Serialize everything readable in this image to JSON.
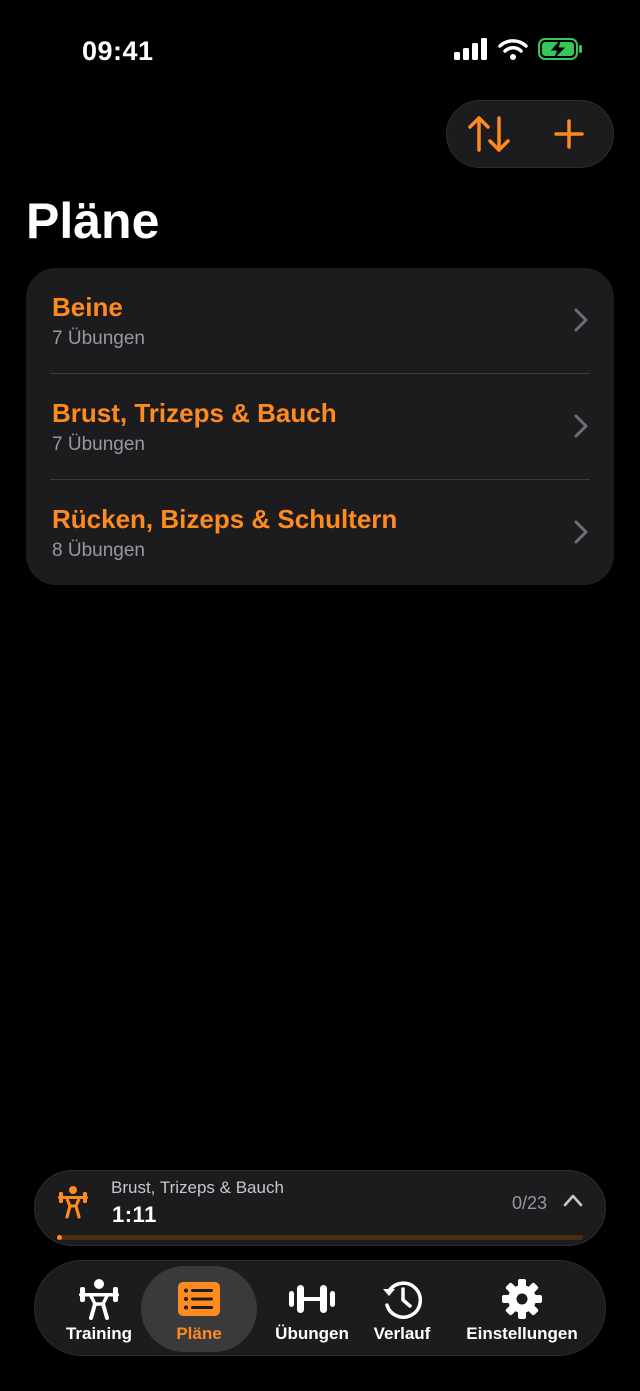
{
  "status_bar": {
    "time": "09:41",
    "icons": [
      "signal-icon",
      "wifi-icon",
      "battery-charging-icon"
    ]
  },
  "toolbar": {
    "icons": [
      "sort-icon",
      "add-icon"
    ]
  },
  "title": "Pläne",
  "plans": [
    {
      "name": "Beine",
      "count": "7 Übungen"
    },
    {
      "name": "Brust, Trizeps & Bauch",
      "count": "7 Übungen"
    },
    {
      "name": "Rücken, Bizeps & Schultern",
      "count": "8 Übungen"
    }
  ],
  "mini_player": {
    "workout_name": "Brust, Trizeps & Bauch",
    "elapsed": "1:11",
    "progress_text": "0/23",
    "progress_fraction": 0.0
  },
  "tabs": [
    {
      "label": "Training",
      "icon": "weightlifter-icon",
      "active": false
    },
    {
      "label": "Pläne",
      "icon": "list-icon",
      "active": true
    },
    {
      "label": "Übungen",
      "icon": "dumbbell-icon",
      "active": false
    },
    {
      "label": "Verlauf",
      "icon": "history-icon",
      "active": false
    },
    {
      "label": "Einstellungen",
      "icon": "gear-icon",
      "active": false
    }
  ],
  "colors": {
    "accent": "#ff8a1f",
    "background": "#000000",
    "card": "#1c1c1e",
    "secondary_text": "#98989f",
    "battery": "#34c759"
  }
}
